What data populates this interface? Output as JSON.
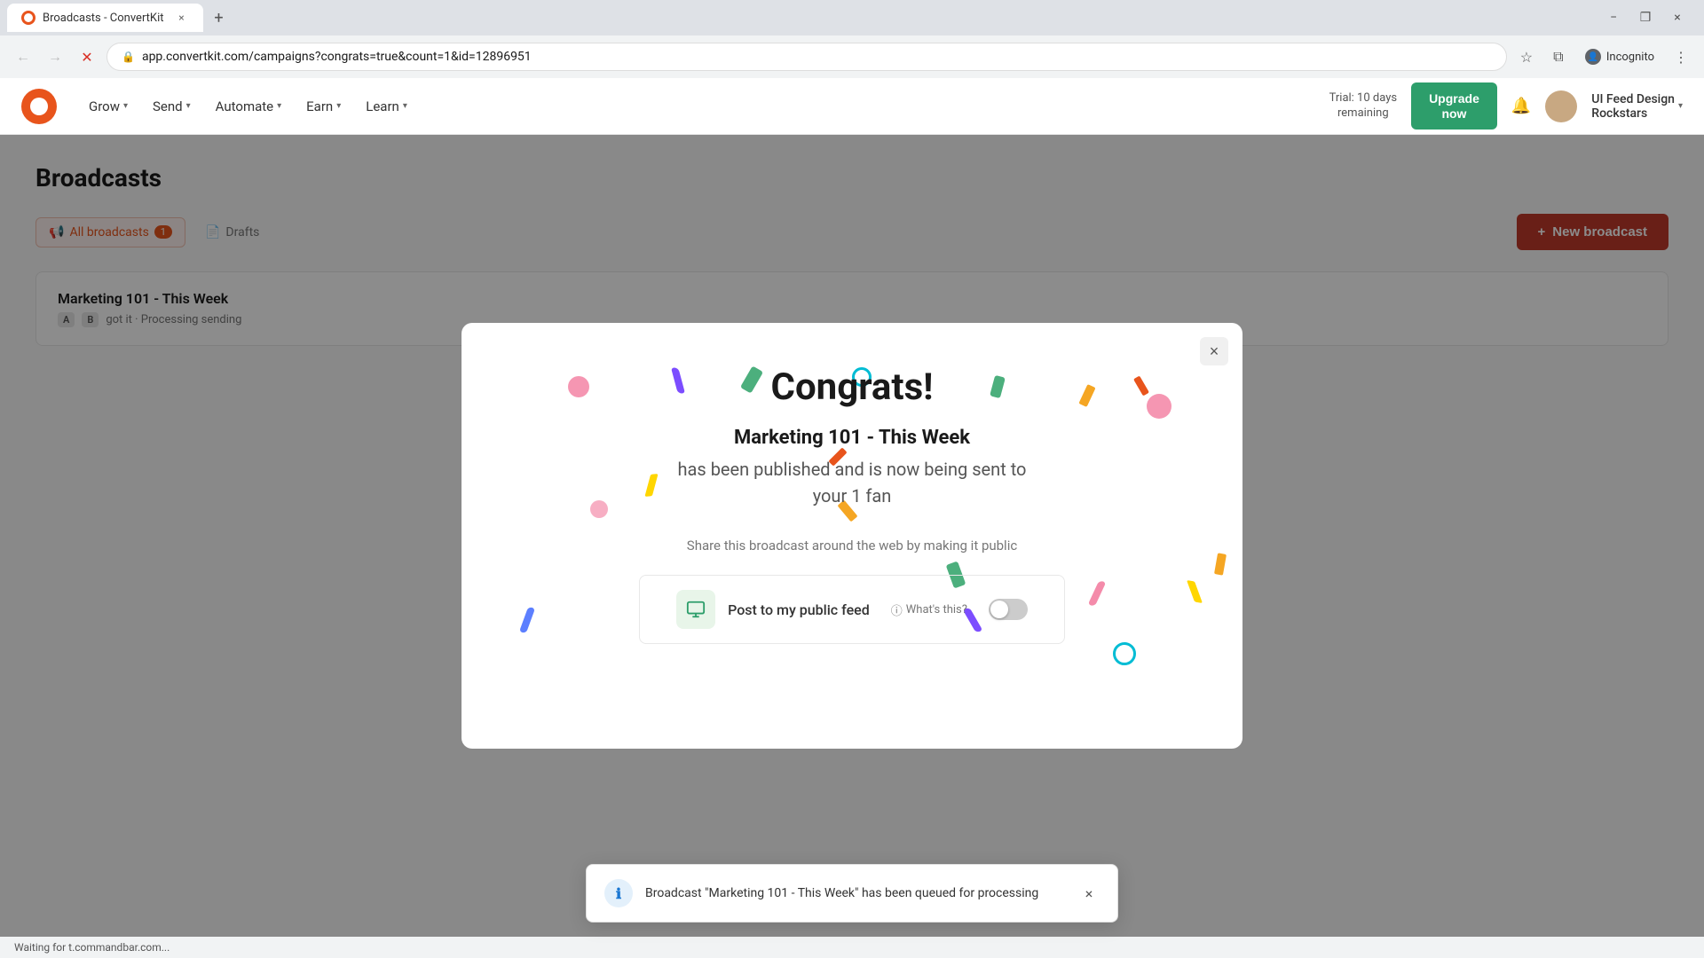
{
  "browser": {
    "tab_title": "Broadcasts - ConvertKit",
    "tab_close": "×",
    "tab_add": "+",
    "address": "app.convertkit.com/campaigns?congrats=true&count=1&id=12896951",
    "incognito_label": "Incognito",
    "window_minimize": "−",
    "window_maximize": "❐",
    "window_close": "×"
  },
  "header": {
    "logo_alt": "ConvertKit",
    "nav": [
      {
        "label": "Grow",
        "has_dropdown": true
      },
      {
        "label": "Send",
        "has_dropdown": true
      },
      {
        "label": "Automate",
        "has_dropdown": true
      },
      {
        "label": "Earn",
        "has_dropdown": true
      },
      {
        "label": "Learn",
        "has_dropdown": true
      }
    ],
    "trial_text": "Trial: 10 days\nremaining",
    "upgrade_label": "Upgrade\nnow",
    "bell_icon": "🔔",
    "user_name": "UI Feed Design\nRockstars",
    "user_chevron": "▾"
  },
  "page": {
    "title": "Broadcasts",
    "filters": [
      {
        "label": "All broadcasts",
        "count": "1",
        "active": true
      },
      {
        "label": "Drafts",
        "active": false
      }
    ],
    "new_broadcast_btn": "New broadcast",
    "broadcast_item": {
      "title": "Marketing 101 - This Week",
      "ab_badge_a": "A",
      "ab_badge_b": "B",
      "meta": "got it · Processing sending"
    }
  },
  "modal": {
    "close_btn": "×",
    "title": "Congrats!",
    "broadcast_name": "Marketing 101 - This Week",
    "description": "has been published and is now being sent to\nyour 1 fan",
    "share_text": "Share this broadcast around the web by making it public",
    "feed_label": "Post to my public feed",
    "whats_this": "What's this?",
    "toggle_state": "off"
  },
  "toast": {
    "message": "Broadcast \"Marketing 101 - This Week\" has been queued for processing",
    "close_btn": "×"
  },
  "status_bar": {
    "text": "Waiting for t.commandbar.com..."
  },
  "colors": {
    "brand_red": "#e8541c",
    "dark_red": "#c0392b",
    "green": "#2d9e6b",
    "accent": "#e8541c"
  }
}
